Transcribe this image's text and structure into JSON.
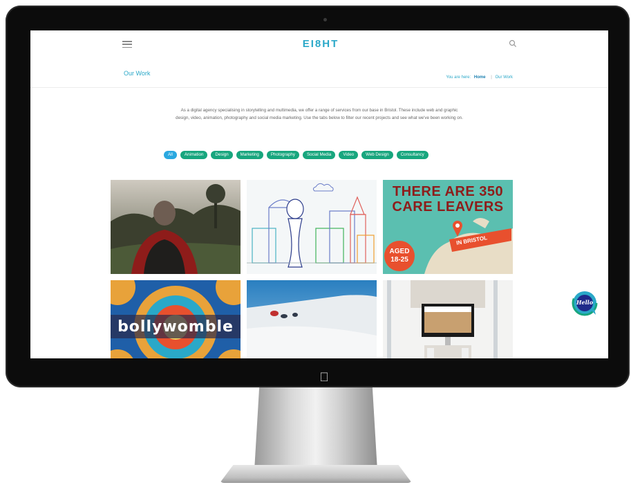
{
  "site": {
    "logo_text": "EI8HT",
    "page_title": "Our Work",
    "breadcrumb": {
      "prefix": "You are here:",
      "home": "Home",
      "separator": "|",
      "current": "Our Work"
    }
  },
  "intro_text": "As a digital agency specialising in storytelling and multimedia, we offer a range of services from our base in Bristol. These include web and graphic design, video, animation, photography and social media marketing. Use the tabs below to filter our recent projects and see what we've been working on.",
  "filters": [
    {
      "label": "All",
      "active": true
    },
    {
      "label": "Animation",
      "active": false
    },
    {
      "label": "Design",
      "active": false
    },
    {
      "label": "Marketing",
      "active": false
    },
    {
      "label": "Photography",
      "active": false
    },
    {
      "label": "Social Media",
      "active": false
    },
    {
      "label": "Video",
      "active": false
    },
    {
      "label": "Web Design",
      "active": false
    },
    {
      "label": "Consultancy",
      "active": false
    }
  ],
  "tiles": {
    "care_leavers": {
      "line1": "THERE ARE 350",
      "line2": "CARE LEAVERS",
      "badge_line1": "AGED",
      "badge_line2": "18-25",
      "ribbon": "IN BRISTOL"
    },
    "bollywomble": {
      "text": "bollywomble"
    }
  },
  "chat_button": {
    "label": "Hello"
  },
  "colors": {
    "brand_blue": "#2aa8c8",
    "filter_green": "#18a67e",
    "filter_active": "#2aa8e0",
    "care_teal": "#5bbfb0",
    "care_orange": "#e8502e"
  },
  "icons": {
    "menu": "hamburger-icon",
    "search": "search-icon",
    "device": "apple-logo-icon",
    "chat": "chat-bubble-icon"
  }
}
